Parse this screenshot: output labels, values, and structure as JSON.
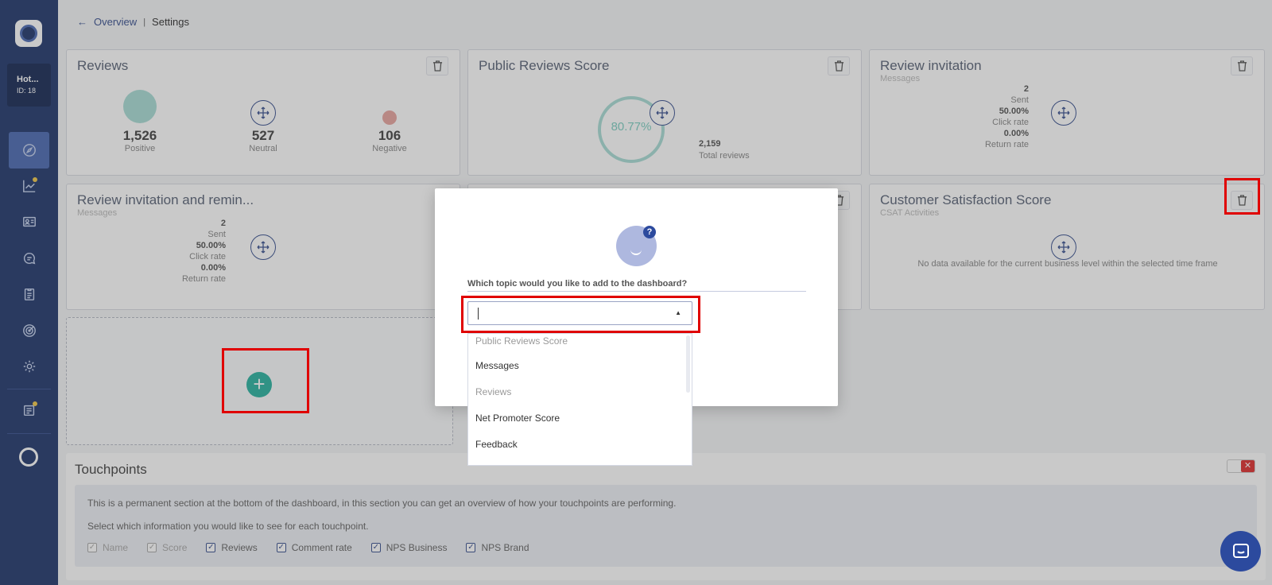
{
  "sidebar": {
    "hotel_name": "Hot...",
    "hotel_id": "ID: 18"
  },
  "breadcrumb": {
    "back_label": "Overview",
    "current": "Settings"
  },
  "cards": {
    "reviews": {
      "title": "Reviews",
      "positive_value": "1,526",
      "positive_label": "Positive",
      "neutral_value": "527",
      "neutral_label": "Neutral",
      "negative_value": "106",
      "negative_label": "Negative"
    },
    "public_score": {
      "title": "Public Reviews Score",
      "score": "80.77%",
      "total_value": "2,159",
      "total_label": "Total reviews"
    },
    "review_invitation": {
      "title": "Review invitation",
      "subtitle": "Messages",
      "sent_value": "2",
      "sent_label": "Sent",
      "click_value": "50.00%",
      "click_label": "Click rate",
      "return_value": "0.00%",
      "return_label": "Return rate"
    },
    "review_invitation_reminder": {
      "title": "Review invitation and remin...",
      "subtitle": "Messages",
      "sent_value": "2",
      "sent_label": "Sent",
      "click_value": "50.00%",
      "click_label": "Click rate",
      "return_value": "0.00%",
      "return_label": "Return rate"
    },
    "csat": {
      "title": "Customer Satisfaction Score",
      "subtitle": "CSAT Activities",
      "empty_message": "No data available for the current business level within the selected time frame"
    }
  },
  "touchpoints": {
    "title": "Touchpoints",
    "description": "This is a permanent section at the bottom of the dashboard, in this section you can get an overview of how your touchpoints are performing.",
    "select_text": "Select which information you would like to see for each touchpoint.",
    "toggle_symbol": "✕",
    "checkboxes": [
      {
        "label": "Name",
        "mark": "✓"
      },
      {
        "label": "Score",
        "mark": "✓"
      },
      {
        "label": "Reviews",
        "mark": "✓"
      },
      {
        "label": "Comment rate",
        "mark": "✓"
      },
      {
        "label": "NPS Business",
        "mark": "✓"
      },
      {
        "label": "NPS Brand",
        "mark": "✓"
      }
    ]
  },
  "modal": {
    "question": "Which topic would you like to add to the dashboard?",
    "badge": "?",
    "select_arrow": "▲",
    "options": [
      {
        "label": "Public Reviews Score",
        "disabled": true
      },
      {
        "label": "Messages",
        "disabled": false
      },
      {
        "label": "Reviews",
        "disabled": true
      },
      {
        "label": "Net Promoter Score",
        "disabled": false
      },
      {
        "label": "Feedback",
        "disabled": false
      }
    ]
  },
  "add_card": {
    "plus": "+"
  },
  "colors": {
    "sidebar": "#233a6e",
    "accent": "#3b5290",
    "teal": "#2bb3a1",
    "highlight": "#e00000"
  }
}
